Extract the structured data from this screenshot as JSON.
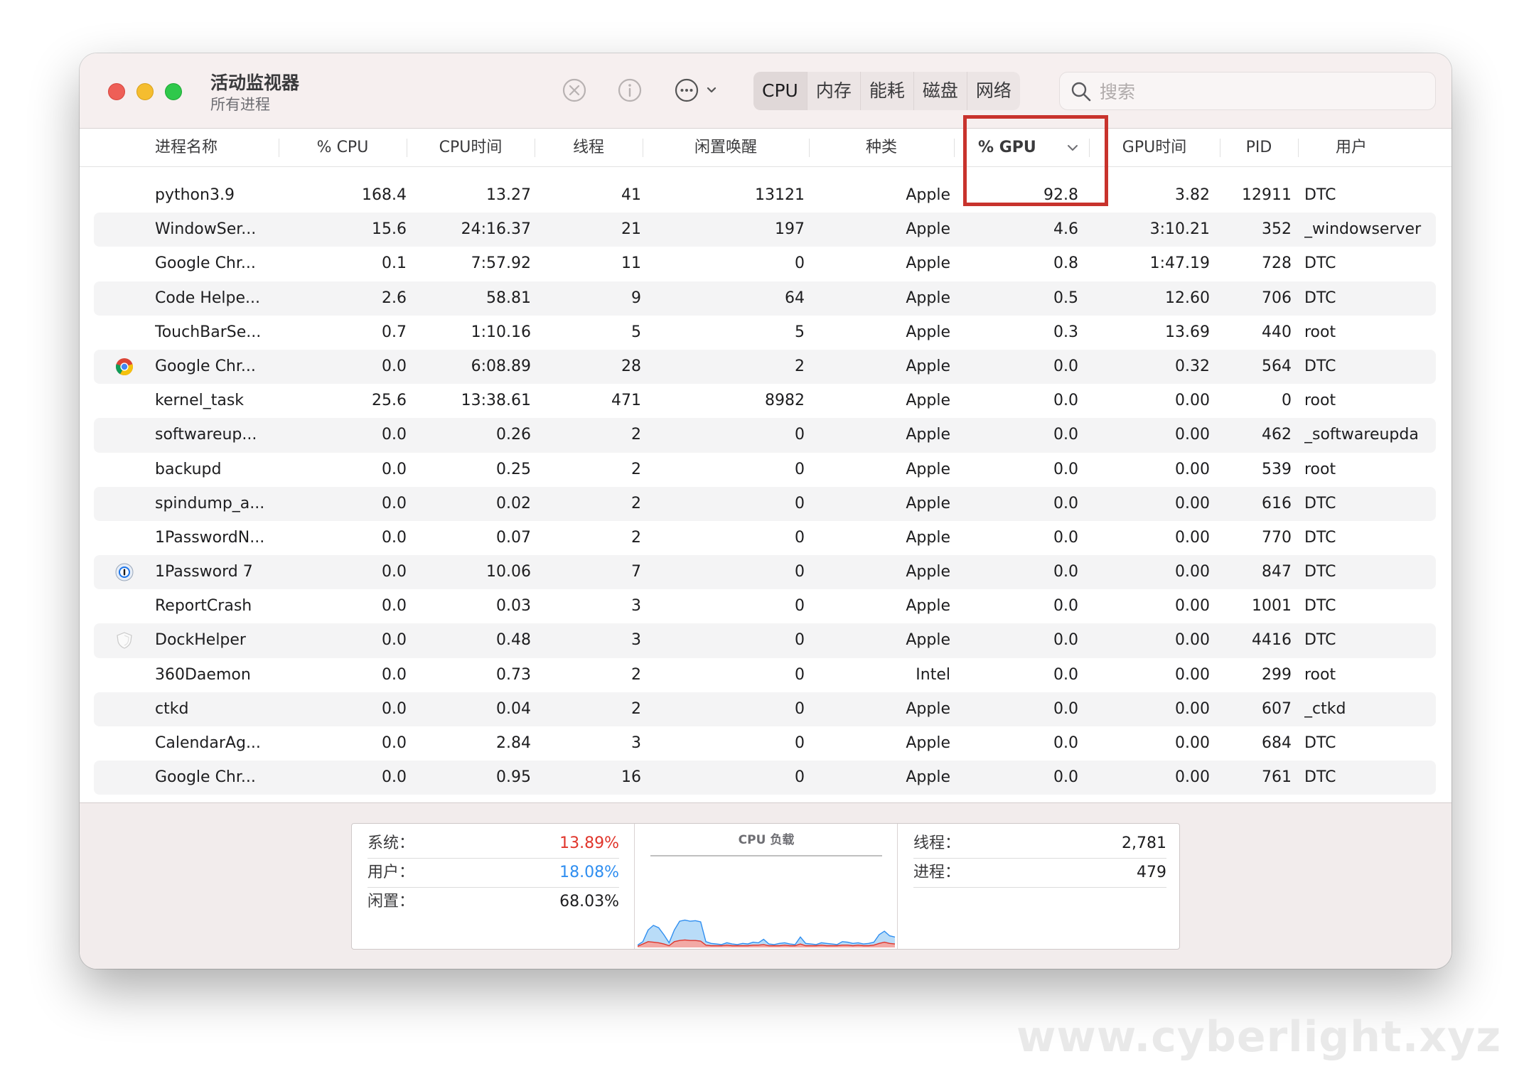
{
  "window": {
    "title": "活动监视器",
    "subtitle": "所有进程"
  },
  "toolbar": {
    "stop_icon": "stop-process-icon",
    "info_icon": "info-icon",
    "more_icon": "more-options-icon",
    "tabs": [
      {
        "label": "CPU",
        "active": true
      },
      {
        "label": "内存",
        "active": false
      },
      {
        "label": "能耗",
        "active": false
      },
      {
        "label": "磁盘",
        "active": false
      },
      {
        "label": "网络",
        "active": false
      }
    ],
    "search_placeholder": "搜索"
  },
  "table": {
    "columns": [
      "进程名称",
      "% CPU",
      "CPU时间",
      "线程",
      "闲置唤醒",
      "种类",
      "% GPU",
      "GPU时间",
      "PID",
      "用户"
    ],
    "sorted_column": "% GPU",
    "rows": [
      {
        "name": "python3.9",
        "cpu": "168.4",
        "cpu_time": "13.27",
        "threads": "41",
        "idle_wakeups": "13121",
        "kind": "Apple",
        "gpu": "92.8",
        "gpu_time": "3.82",
        "pid": "12911",
        "user": "DTC",
        "icon": ""
      },
      {
        "name": "WindowSer...",
        "cpu": "15.6",
        "cpu_time": "24:16.37",
        "threads": "21",
        "idle_wakeups": "197",
        "kind": "Apple",
        "gpu": "4.6",
        "gpu_time": "3:10.21",
        "pid": "352",
        "user": "_windowserver",
        "icon": ""
      },
      {
        "name": "Google Chr...",
        "cpu": "0.1",
        "cpu_time": "7:57.92",
        "threads": "11",
        "idle_wakeups": "0",
        "kind": "Apple",
        "gpu": "0.8",
        "gpu_time": "1:47.19",
        "pid": "728",
        "user": "DTC",
        "icon": ""
      },
      {
        "name": "Code Helpe...",
        "cpu": "2.6",
        "cpu_time": "58.81",
        "threads": "9",
        "idle_wakeups": "64",
        "kind": "Apple",
        "gpu": "0.5",
        "gpu_time": "12.60",
        "pid": "706",
        "user": "DTC",
        "icon": ""
      },
      {
        "name": "TouchBarSe...",
        "cpu": "0.7",
        "cpu_time": "1:10.16",
        "threads": "5",
        "idle_wakeups": "5",
        "kind": "Apple",
        "gpu": "0.3",
        "gpu_time": "13.69",
        "pid": "440",
        "user": "root",
        "icon": ""
      },
      {
        "name": "Google Chr...",
        "cpu": "0.0",
        "cpu_time": "6:08.89",
        "threads": "28",
        "idle_wakeups": "2",
        "kind": "Apple",
        "gpu": "0.0",
        "gpu_time": "0.32",
        "pid": "564",
        "user": "DTC",
        "icon": "chrome-icon"
      },
      {
        "name": "kernel_task",
        "cpu": "25.6",
        "cpu_time": "13:38.61",
        "threads": "471",
        "idle_wakeups": "8982",
        "kind": "Apple",
        "gpu": "0.0",
        "gpu_time": "0.00",
        "pid": "0",
        "user": "root",
        "icon": ""
      },
      {
        "name": "softwareup...",
        "cpu": "0.0",
        "cpu_time": "0.26",
        "threads": "2",
        "idle_wakeups": "0",
        "kind": "Apple",
        "gpu": "0.0",
        "gpu_time": "0.00",
        "pid": "462",
        "user": "_softwareupda",
        "icon": ""
      },
      {
        "name": "backupd",
        "cpu": "0.0",
        "cpu_time": "0.25",
        "threads": "2",
        "idle_wakeups": "0",
        "kind": "Apple",
        "gpu": "0.0",
        "gpu_time": "0.00",
        "pid": "539",
        "user": "root",
        "icon": ""
      },
      {
        "name": "spindump_a...",
        "cpu": "0.0",
        "cpu_time": "0.02",
        "threads": "2",
        "idle_wakeups": "0",
        "kind": "Apple",
        "gpu": "0.0",
        "gpu_time": "0.00",
        "pid": "616",
        "user": "DTC",
        "icon": ""
      },
      {
        "name": "1PasswordN...",
        "cpu": "0.0",
        "cpu_time": "0.07",
        "threads": "2",
        "idle_wakeups": "0",
        "kind": "Apple",
        "gpu": "0.0",
        "gpu_time": "0.00",
        "pid": "770",
        "user": "DTC",
        "icon": ""
      },
      {
        "name": "1Password 7",
        "cpu": "0.0",
        "cpu_time": "10.06",
        "threads": "7",
        "idle_wakeups": "0",
        "kind": "Apple",
        "gpu": "0.0",
        "gpu_time": "0.00",
        "pid": "847",
        "user": "DTC",
        "icon": "onepassword-icon"
      },
      {
        "name": "ReportCrash",
        "cpu": "0.0",
        "cpu_time": "0.03",
        "threads": "3",
        "idle_wakeups": "0",
        "kind": "Apple",
        "gpu": "0.0",
        "gpu_time": "0.00",
        "pid": "1001",
        "user": "DTC",
        "icon": ""
      },
      {
        "name": "DockHelper",
        "cpu": "0.0",
        "cpu_time": "0.48",
        "threads": "3",
        "idle_wakeups": "0",
        "kind": "Apple",
        "gpu": "0.0",
        "gpu_time": "0.00",
        "pid": "4416",
        "user": "DTC",
        "icon": "shield-icon"
      },
      {
        "name": "360Daemon",
        "cpu": "0.0",
        "cpu_time": "0.73",
        "threads": "2",
        "idle_wakeups": "0",
        "kind": "Intel",
        "gpu": "0.0",
        "gpu_time": "0.00",
        "pid": "299",
        "user": "root",
        "icon": ""
      },
      {
        "name": "ctkd",
        "cpu": "0.0",
        "cpu_time": "0.04",
        "threads": "2",
        "idle_wakeups": "0",
        "kind": "Apple",
        "gpu": "0.0",
        "gpu_time": "0.00",
        "pid": "607",
        "user": "_ctkd",
        "icon": ""
      },
      {
        "name": "CalendarAg...",
        "cpu": "0.0",
        "cpu_time": "2.84",
        "threads": "3",
        "idle_wakeups": "0",
        "kind": "Apple",
        "gpu": "0.0",
        "gpu_time": "0.00",
        "pid": "684",
        "user": "DTC",
        "icon": ""
      },
      {
        "name": "Google Chr...",
        "cpu": "0.0",
        "cpu_time": "0.95",
        "threads": "16",
        "idle_wakeups": "0",
        "kind": "Apple",
        "gpu": "0.0",
        "gpu_time": "0.00",
        "pid": "761",
        "user": "DTC",
        "icon": ""
      }
    ]
  },
  "summary": {
    "system_label": "系统：",
    "system_value": "13.89%",
    "user_label": "用户：",
    "user_value": "18.08%",
    "idle_label": "闲置：",
    "idle_value": "68.03%",
    "graph_title": "CPU 负载",
    "threads_label": "线程：",
    "threads_value": "2,781",
    "processes_label": "进程：",
    "processes_value": "479"
  },
  "colors": {
    "system": "#e0352b",
    "user": "#2f8ef0",
    "highlight_box": "#c8332d",
    "cpu_user_fill": "#b9dcf8",
    "cpu_system_fill": "#f2a9a5"
  },
  "cpu_load_series": {
    "user_percent": [
      4,
      10,
      30,
      38,
      34,
      22,
      8,
      30,
      45,
      47,
      45,
      46,
      44,
      10,
      7,
      6,
      5,
      8,
      6,
      5,
      7,
      6,
      9,
      8,
      14,
      6,
      5,
      7,
      8,
      6,
      5,
      18,
      7,
      6,
      5,
      8,
      7,
      6,
      5,
      10,
      9,
      7,
      8,
      6,
      7,
      9,
      22,
      28,
      20,
      18
    ],
    "system_percent": [
      2,
      6,
      10,
      9,
      8,
      6,
      3,
      10,
      12,
      13,
      12,
      12,
      11,
      4,
      3,
      3,
      3,
      4,
      3,
      3,
      3,
      3,
      4,
      4,
      5,
      3,
      3,
      3,
      4,
      3,
      3,
      6,
      3,
      3,
      3,
      4,
      3,
      3,
      3,
      4,
      4,
      3,
      4,
      3,
      3,
      4,
      7,
      9,
      7,
      6
    ]
  },
  "watermark": "www.cyberlight.xyz"
}
